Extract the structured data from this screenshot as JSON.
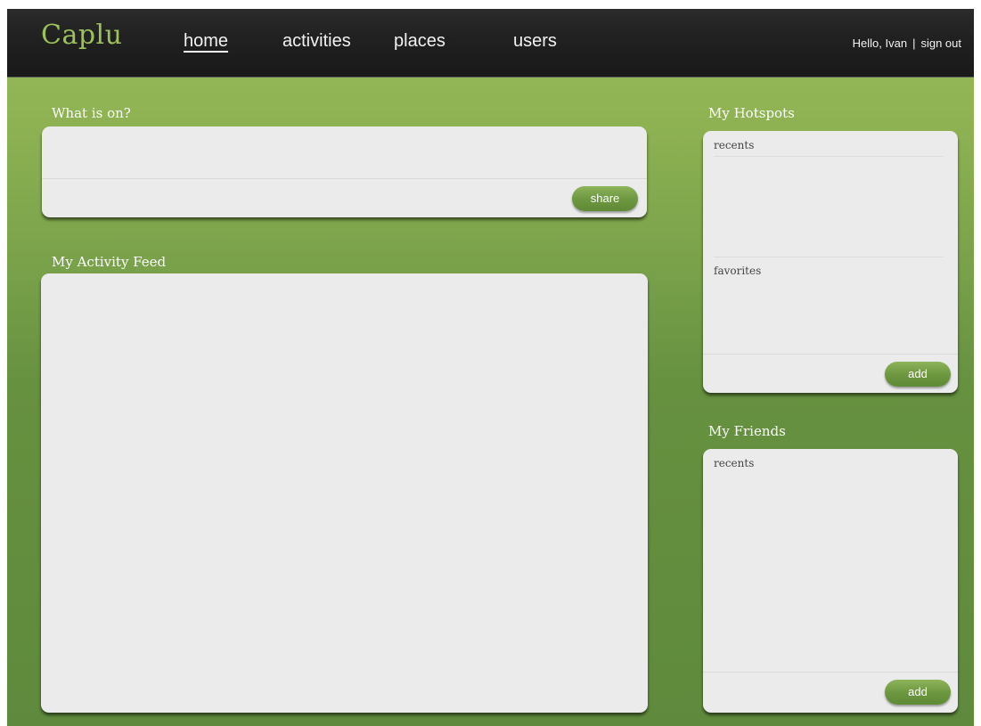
{
  "header": {
    "logo": "Caplu",
    "nav": {
      "home": "home",
      "activities": "activities",
      "places": "places",
      "users": "users"
    },
    "active_nav": "home",
    "greeting": "Hello, Ivan",
    "separator": "|",
    "sign_out": "sign out"
  },
  "status_box": {
    "title": "What is on?",
    "input_value": "",
    "share_label": "share"
  },
  "activity_feed": {
    "title": "My Activity Feed"
  },
  "hotspots": {
    "title": "My Hotspots",
    "recents_label": "recents",
    "favorites_label": "favorites",
    "add_label": "add"
  },
  "friends": {
    "title": "My Friends",
    "recents_label": "recents",
    "add_label": "add"
  },
  "colors": {
    "brand_green": "#9cc25a",
    "topbar": "#202020",
    "panel": "#ebebeb",
    "button_green": "#6c963f"
  }
}
